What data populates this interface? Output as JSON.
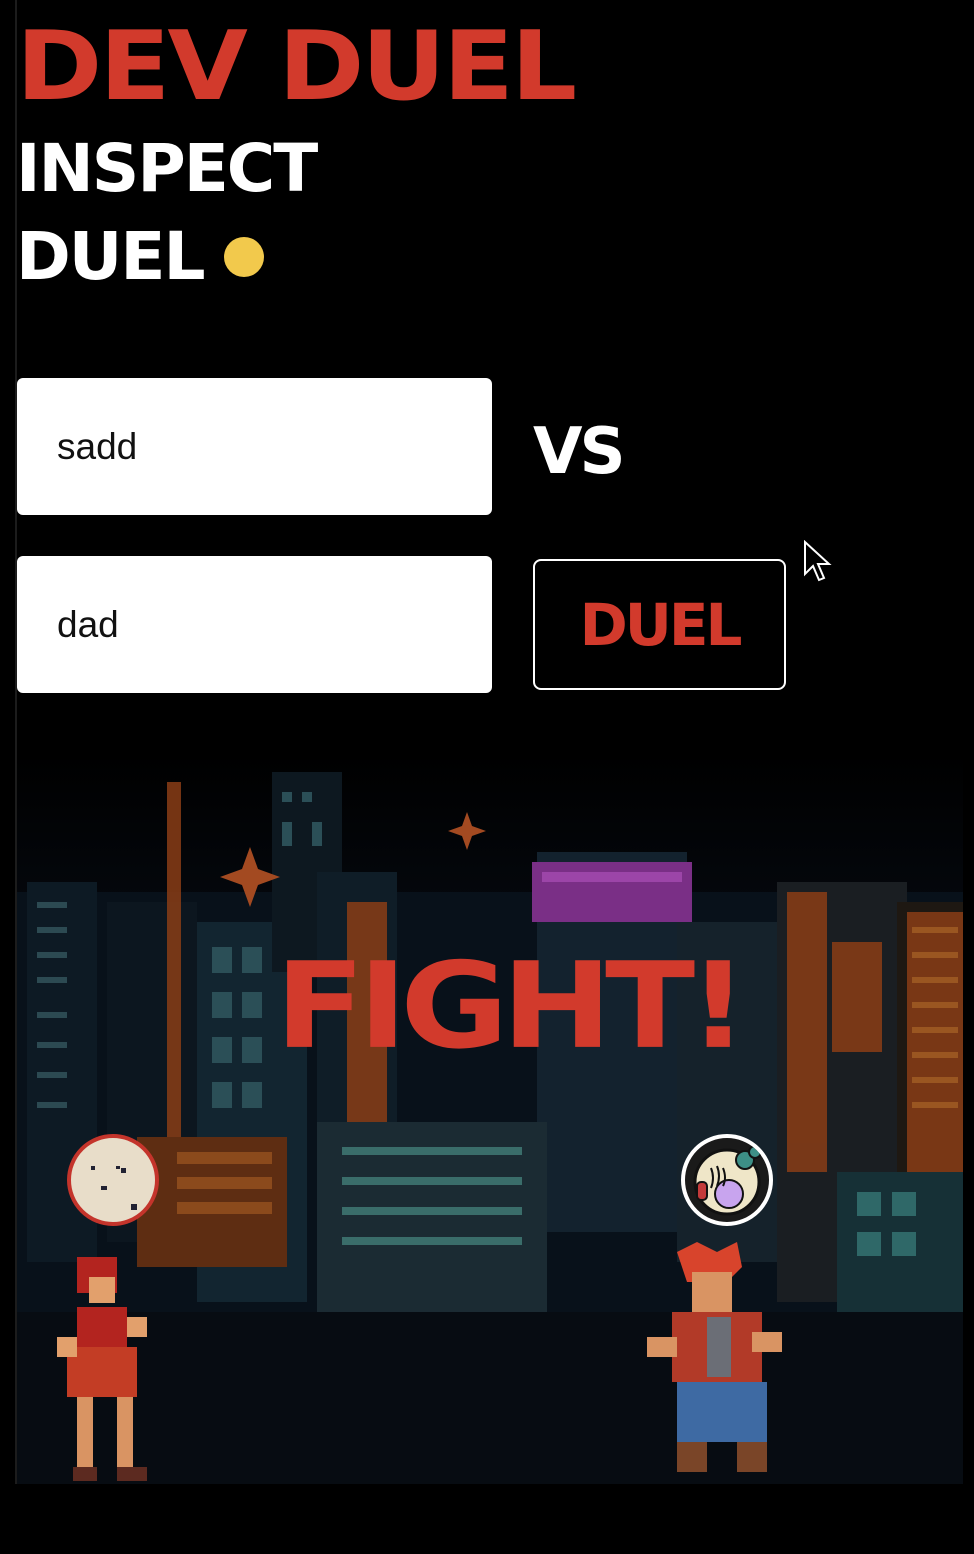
{
  "header": {
    "title": "DEV DUEL",
    "subtitle_line1": "INSPECT",
    "subtitle_line2": "DUEL",
    "status_dot_color": "#f2c94c"
  },
  "duel_form": {
    "user1_value": "sadd",
    "user2_value": "dad",
    "vs_label": "VS",
    "duel_button_label": "DUEL"
  },
  "arena": {
    "banner": "FIGHT!",
    "player1_avatar_icon": "cookie-avatar-icon",
    "player2_avatar_icon": "cell-avatar-icon"
  },
  "colors": {
    "accent_red": "#d23a2c",
    "background": "#000000",
    "text_light": "#ffffff"
  }
}
